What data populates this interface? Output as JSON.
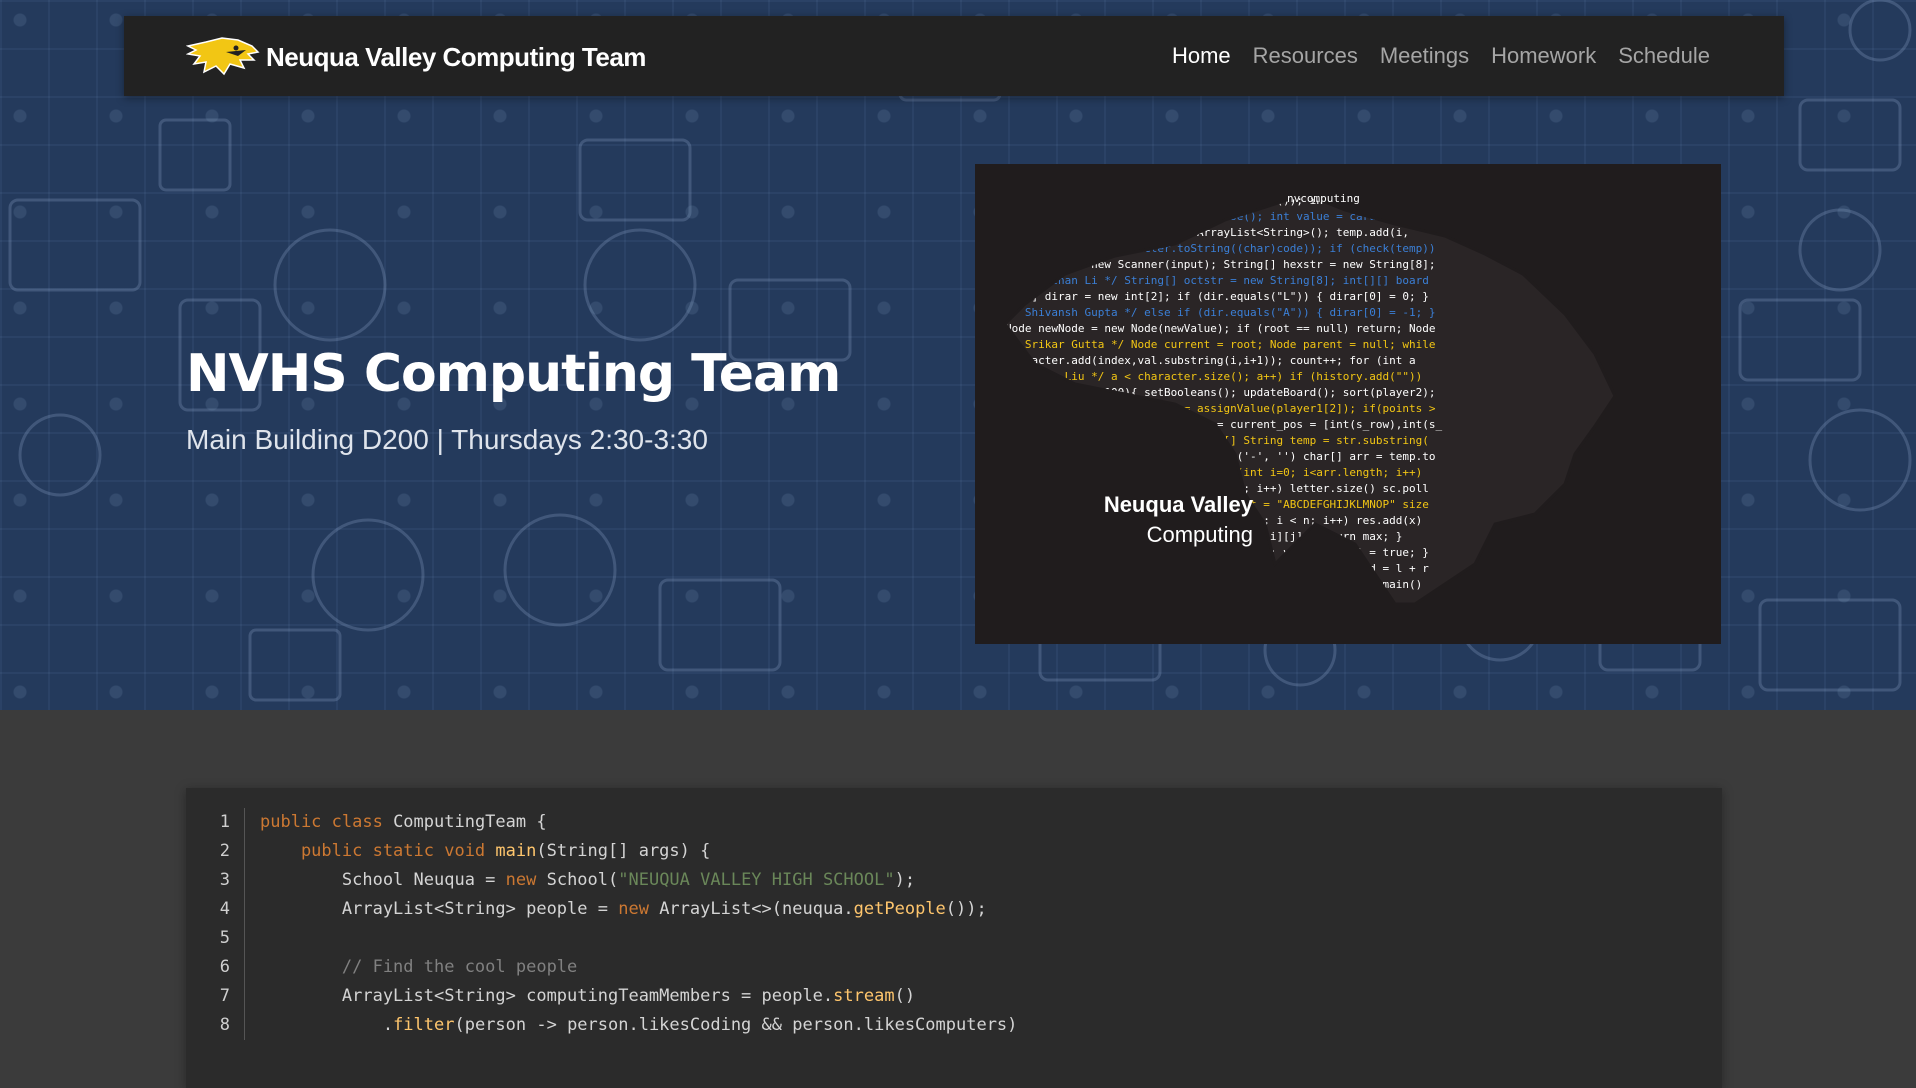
{
  "navbar": {
    "brand": "Neuqua Valley Computing Team",
    "links": [
      {
        "label": "Home",
        "active": true
      },
      {
        "label": "Resources",
        "active": false
      },
      {
        "label": "Meetings",
        "active": false
      },
      {
        "label": "Homework",
        "active": false
      },
      {
        "label": "Schedule",
        "active": false
      }
    ]
  },
  "hero": {
    "title": "NVHS Computing Team",
    "subtitle": "Main Building D200 | Thursdays 2:30-3:30",
    "logo": {
      "line1": "Neuqua Valley",
      "line2": "Computing"
    }
  },
  "code": {
    "line_numbers": [
      "1",
      "2",
      "3",
      "4",
      "5",
      "6",
      "7",
      "8"
    ],
    "lines": [
      [
        {
          "t": "public class ",
          "c": "kw"
        },
        {
          "t": "ComputingTeam {",
          "c": ""
        }
      ],
      [
        {
          "t": "    public static void ",
          "c": "kw"
        },
        {
          "t": "main",
          "c": "fn"
        },
        {
          "t": "(String[] args) {",
          "c": ""
        }
      ],
      [
        {
          "t": "        School Neuqua = ",
          "c": ""
        },
        {
          "t": "new ",
          "c": "kw"
        },
        {
          "t": "School(",
          "c": ""
        },
        {
          "t": "\"NEUQUA VALLEY HIGH SCHOOL\"",
          "c": "str"
        },
        {
          "t": ");",
          "c": ""
        }
      ],
      [
        {
          "t": "        ArrayList<String> people = ",
          "c": ""
        },
        {
          "t": "new ",
          "c": "kw"
        },
        {
          "t": "ArrayList<>(neuqua.",
          "c": ""
        },
        {
          "t": "getPeople",
          "c": "fn"
        },
        {
          "t": "());",
          "c": ""
        }
      ],
      [
        {
          "t": "",
          "c": ""
        }
      ],
      [
        {
          "t": "        // Find the cool people",
          "c": "cmt"
        }
      ],
      [
        {
          "t": "        ArrayList<String> computingTeamMembers = people.",
          "c": ""
        },
        {
          "t": "stream",
          "c": "fn"
        },
        {
          "t": "()",
          "c": ""
        }
      ],
      [
        {
          "t": "            .",
          "c": ""
        },
        {
          "t": "filter",
          "c": "fn"
        },
        {
          "t": "(person -> person.likesCoding && person.likesComputers)",
          "c": ""
        }
      ]
    ]
  },
  "colors": {
    "hero_bg": "#243a5c",
    "navbar_bg": "#222222",
    "page_bg": "#3b3b3b",
    "code_bg": "#2b2b2b",
    "logo_yellow": "#f2c614",
    "keyword": "#cc7832",
    "function": "#ffc66d",
    "string": "#6a8759",
    "comment": "#808080"
  },
  "icons": [
    "eagle-logo-icon"
  ]
}
